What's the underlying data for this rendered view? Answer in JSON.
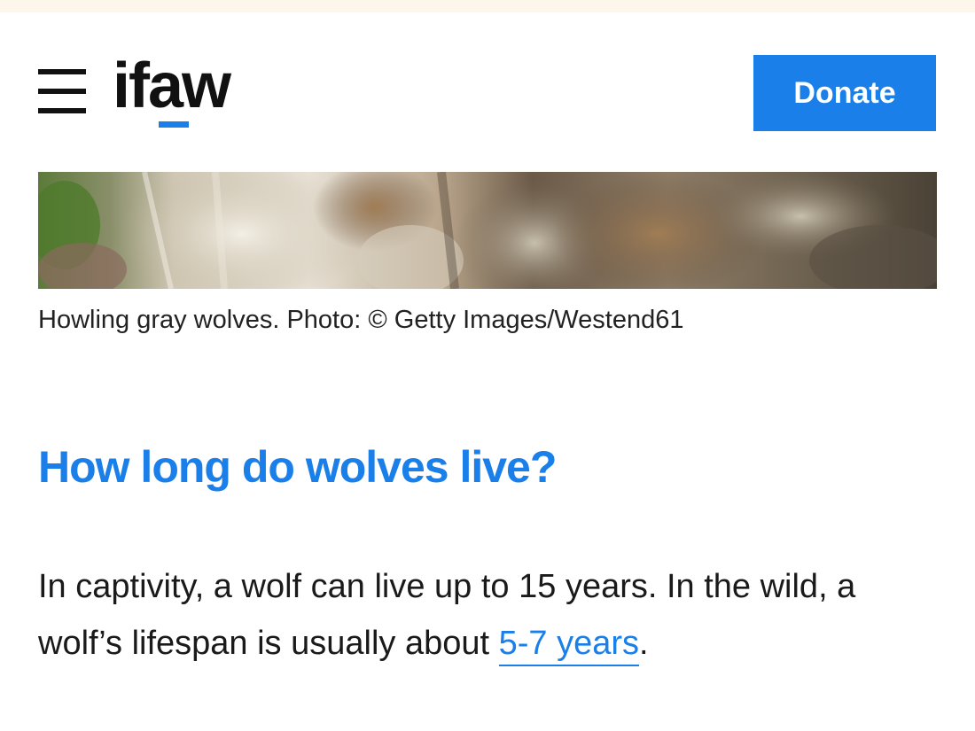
{
  "header": {
    "logo_text": "ifaw",
    "donate_label": "Donate"
  },
  "hero": {
    "caption": "Howling gray wolves. Photo: © Getty Images/Westend61"
  },
  "article": {
    "heading": "How long do wolves live?",
    "paragraph_part1": "In captivity, a wolf can live up to 15 years. In the wild, a wolf’s lifespan is usually about ",
    "paragraph_link": "5-7 years",
    "paragraph_part2": "."
  },
  "colors": {
    "brand_blue": "#1a7fe8",
    "top_strip": "#fdf6ea"
  },
  "icons": {
    "menu": "hamburger-menu-icon"
  }
}
